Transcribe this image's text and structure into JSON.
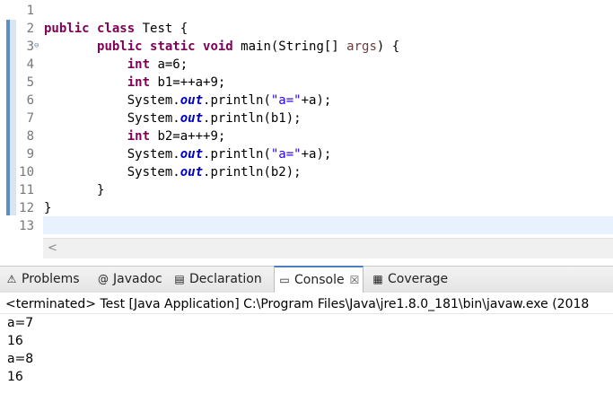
{
  "editor": {
    "lines": [
      {
        "num": "1",
        "code": []
      },
      {
        "num": "2",
        "code": [
          {
            "t": "public class",
            "c": "kw"
          },
          {
            "t": " Test {",
            "c": ""
          }
        ]
      },
      {
        "num": "3",
        "fold": true,
        "code": [
          {
            "t": "       ",
            "c": ""
          },
          {
            "t": "public static void",
            "c": "kw"
          },
          {
            "t": " main(String[] ",
            "c": ""
          },
          {
            "t": "args",
            "c": "dim"
          },
          {
            "t": ") {",
            "c": ""
          }
        ]
      },
      {
        "num": "4",
        "code": [
          {
            "t": "           ",
            "c": ""
          },
          {
            "t": "int",
            "c": "kw"
          },
          {
            "t": " a=6;",
            "c": ""
          }
        ]
      },
      {
        "num": "5",
        "code": [
          {
            "t": "           ",
            "c": ""
          },
          {
            "t": "int",
            "c": "kw"
          },
          {
            "t": " b1=++a+9;",
            "c": ""
          }
        ]
      },
      {
        "num": "6",
        "code": [
          {
            "t": "           System.",
            "c": ""
          },
          {
            "t": "out",
            "c": "fld"
          },
          {
            "t": ".println(",
            "c": ""
          },
          {
            "t": "\"a=\"",
            "c": "str"
          },
          {
            "t": "+a);",
            "c": ""
          }
        ]
      },
      {
        "num": "7",
        "code": [
          {
            "t": "           System.",
            "c": ""
          },
          {
            "t": "out",
            "c": "fld"
          },
          {
            "t": ".println(b1);",
            "c": ""
          }
        ]
      },
      {
        "num": "8",
        "code": [
          {
            "t": "           ",
            "c": ""
          },
          {
            "t": "int",
            "c": "kw"
          },
          {
            "t": " b2=a+++9;",
            "c": ""
          }
        ]
      },
      {
        "num": "9",
        "code": [
          {
            "t": "           System.",
            "c": ""
          },
          {
            "t": "out",
            "c": "fld"
          },
          {
            "t": ".println(",
            "c": ""
          },
          {
            "t": "\"a=\"",
            "c": "str"
          },
          {
            "t": "+a);",
            "c": ""
          }
        ]
      },
      {
        "num": "10",
        "code": [
          {
            "t": "           System.",
            "c": ""
          },
          {
            "t": "out",
            "c": "fld"
          },
          {
            "t": ".println(b2);",
            "c": ""
          }
        ]
      },
      {
        "num": "11",
        "code": [
          {
            "t": "       }",
            "c": ""
          }
        ]
      },
      {
        "num": "12",
        "code": [
          {
            "t": "}",
            "c": ""
          }
        ]
      },
      {
        "num": "13",
        "code": []
      }
    ],
    "scroll_left_glyph": "<"
  },
  "tabs": [
    {
      "label": "Problems",
      "icon": "problems-icon",
      "glyph": "⚠",
      "active": false
    },
    {
      "label": "Javadoc",
      "icon": "javadoc-icon",
      "glyph": "@",
      "active": false
    },
    {
      "label": "Declaration",
      "icon": "declaration-icon",
      "glyph": "▤",
      "active": false
    },
    {
      "label": "Console",
      "icon": "console-icon",
      "glyph": "▭",
      "active": true,
      "close": "☒"
    },
    {
      "label": "Coverage",
      "icon": "coverage-icon",
      "glyph": "▦",
      "active": false
    }
  ],
  "console": {
    "header": "<terminated> Test [Java Application] C:\\Program Files\\Java\\jre1.8.0_181\\bin\\javaw.exe (2018",
    "output": [
      "a=7",
      "16",
      "a=8",
      "16"
    ]
  }
}
